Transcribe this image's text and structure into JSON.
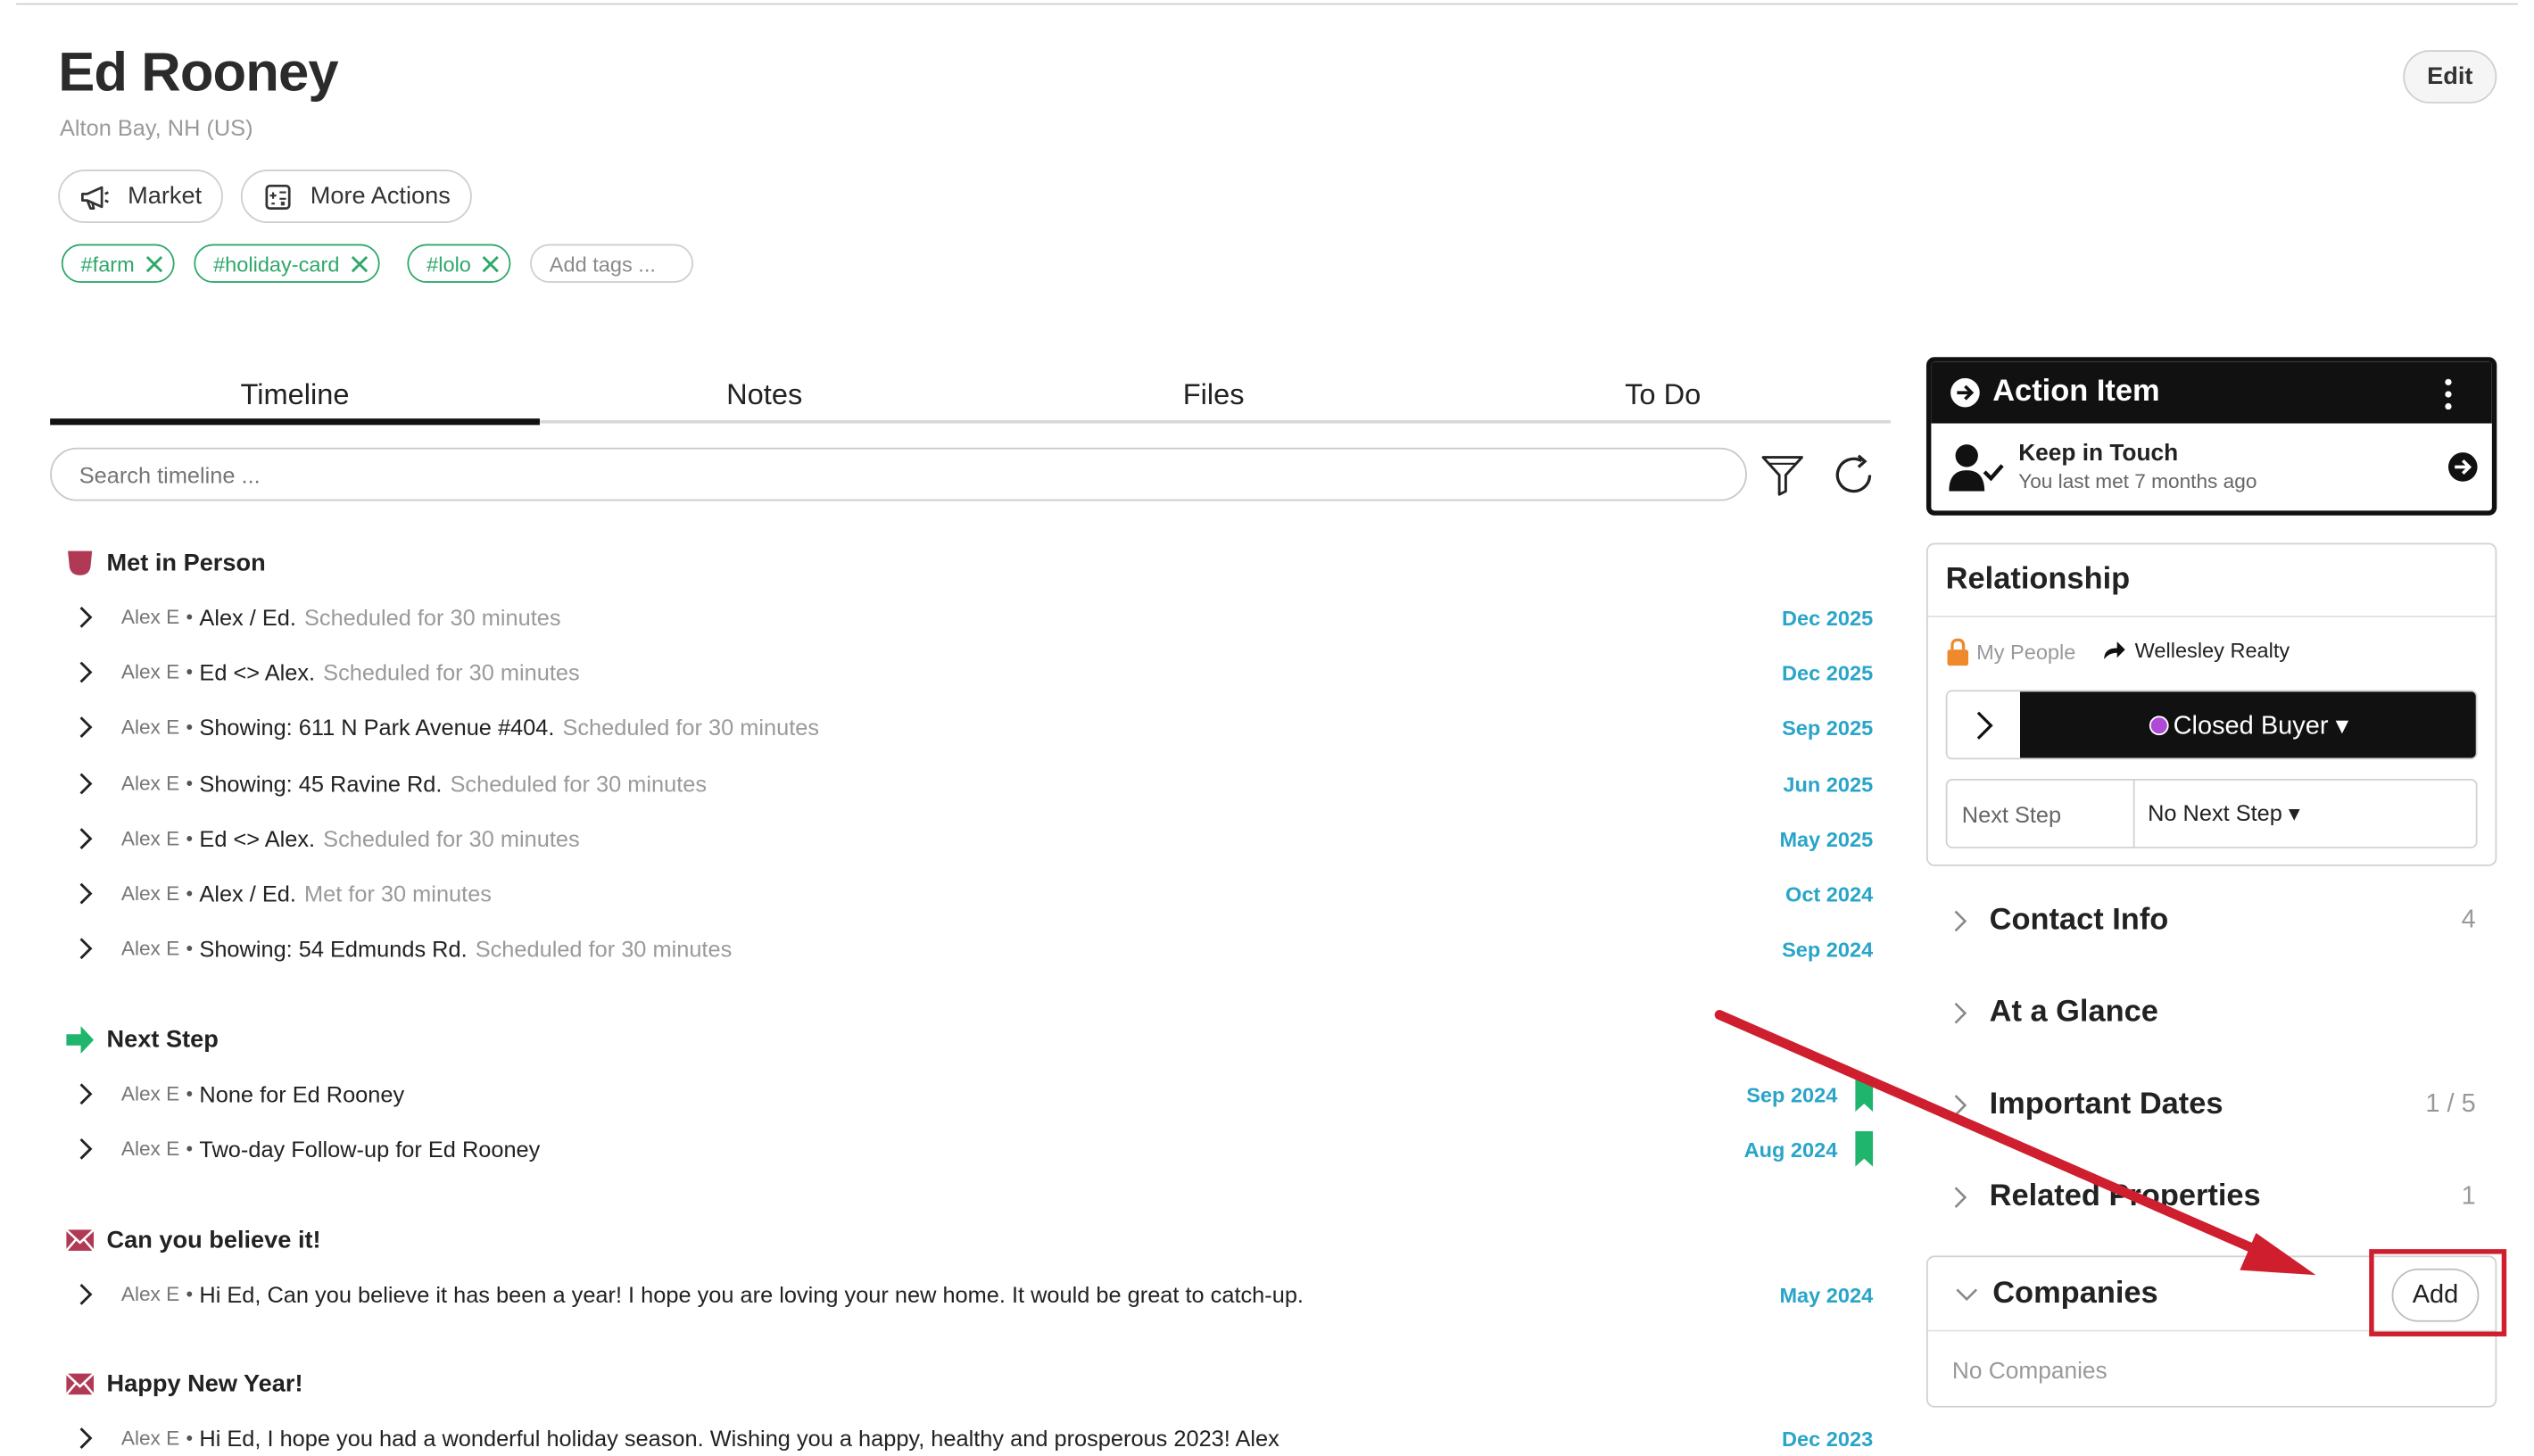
{
  "contact": {
    "name": "Ed Rooney",
    "location": "Alton Bay, NH (US)",
    "edit_label": "Edit"
  },
  "actions": {
    "market_label": "Market",
    "more_actions_label": "More Actions"
  },
  "tags": [
    "#farm",
    "#holiday-card",
    "#lolo"
  ],
  "add_tags_placeholder": "Add tags ...",
  "tabs": [
    "Timeline",
    "Notes",
    "Files",
    "To Do"
  ],
  "active_tab": "Timeline",
  "search": {
    "placeholder": "Search timeline ..."
  },
  "timeline": {
    "groups": [
      {
        "heading": "Met in Person",
        "icon": "coffee-cup-icon",
        "rows": [
          {
            "author": "Alex E",
            "title": "Alex / Ed.",
            "detail": "Scheduled for 30 minutes",
            "date": "Dec 2025"
          },
          {
            "author": "Alex E",
            "title": "Ed <> Alex.",
            "detail": "Scheduled for 30 minutes",
            "date": "Dec 2025"
          },
          {
            "author": "Alex E",
            "title": "Showing: 611 N Park Avenue #404.",
            "detail": "Scheduled for 30 minutes",
            "date": "Sep 2025"
          },
          {
            "author": "Alex E",
            "title": "Showing: 45 Ravine Rd.",
            "detail": "Scheduled for 30 minutes",
            "date": "Jun 2025"
          },
          {
            "author": "Alex E",
            "title": "Ed <> Alex.",
            "detail": "Scheduled for 30 minutes",
            "date": "May 2025"
          },
          {
            "author": "Alex E",
            "title": "Alex / Ed.",
            "detail": "Met for 30 minutes",
            "date": "Oct 2024"
          },
          {
            "author": "Alex E",
            "title": "Showing: 54 Edmunds Rd.",
            "detail": "Scheduled for 30 minutes",
            "date": "Sep 2024"
          }
        ]
      },
      {
        "heading": "Next Step",
        "icon": "arrow-right-icon",
        "rows": [
          {
            "author": "Alex E",
            "title": "None for Ed Rooney",
            "detail": "",
            "date": "Sep 2024"
          },
          {
            "author": "Alex E",
            "title": "Two-day Follow-up for Ed Rooney",
            "detail": "",
            "date": "Aug 2024"
          }
        ]
      },
      {
        "heading": "Can you believe it!",
        "icon": "envelope-icon",
        "rows": [
          {
            "author": "Alex E",
            "title": "Hi Ed, Can you believe it has been a year! I hope you are loving your new home. It would be great to catch-up.",
            "detail": "",
            "date": "May 2024"
          }
        ]
      },
      {
        "heading": "Happy New Year!",
        "icon": "envelope-icon",
        "rows": [
          {
            "author": "Alex E",
            "title": "Hi Ed, I hope you had a wonderful holiday season.  Wishing you a happy, healthy and prosperous 2023! Alex",
            "detail": "",
            "date": "Dec 2023"
          }
        ]
      }
    ]
  },
  "action_item": {
    "heading": "Action Item",
    "title": "Keep in Touch",
    "subtitle": "You last met 7 months ago"
  },
  "relationship": {
    "heading": "Relationship",
    "owner": "My People",
    "company": "Wellesley Realty",
    "stage": "Closed Buyer ▾",
    "next_step_label": "Next Step",
    "next_step_value": "No Next Step ▾"
  },
  "sections": [
    {
      "label": "Contact Info",
      "count": "4"
    },
    {
      "label": "At a Glance",
      "count": ""
    },
    {
      "label": "Important Dates",
      "count": "1 / 5"
    },
    {
      "label": "Related Properties",
      "count": "1"
    }
  ],
  "companies": {
    "heading": "Companies",
    "empty_text": "No Companies",
    "add_label": "Add"
  },
  "colors": {
    "tag_green": "#2fa86a",
    "date_blue": "#2aa5c9",
    "stage_purple": "#b04ad6",
    "annotation_red": "#cf1e2e",
    "bookmark_green": "#1fb56c",
    "coffee_red": "#b03a55",
    "lock_orange": "#ee8a2d"
  }
}
